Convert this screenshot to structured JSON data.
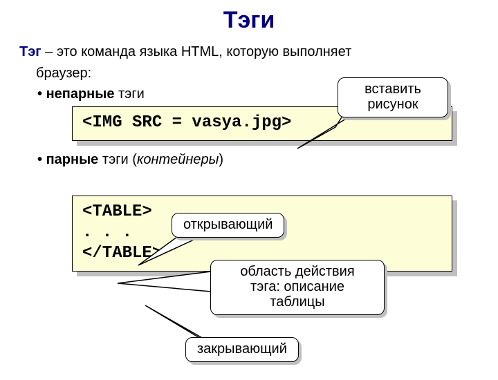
{
  "title": "Тэги",
  "intro_lead": "Тэг",
  "intro_rest": " – это команда языка HTML, которую выполняет",
  "intro_line2": "браузер:",
  "bullet1_bold": "непарные",
  "bullet1_rest": " тэги",
  "code1": "<IMG SRC = vasya.jpg>",
  "bullet2_bold": "парные",
  "bullet2_rest": " тэги (",
  "bullet2_italic": "контейнеры",
  "bullet2_close": ")",
  "code2_l1": "<TABLE>",
  "code2_l2": ". . .",
  "code2_l3": "</TABLE>",
  "callouts": {
    "insert_l1": "вставить",
    "insert_l2": "рисунок",
    "opening": "открывающий",
    "area_l1": "область действия",
    "area_l2": "тэга: описание",
    "area_l3": "таблицы",
    "closing": "закрывающий"
  }
}
